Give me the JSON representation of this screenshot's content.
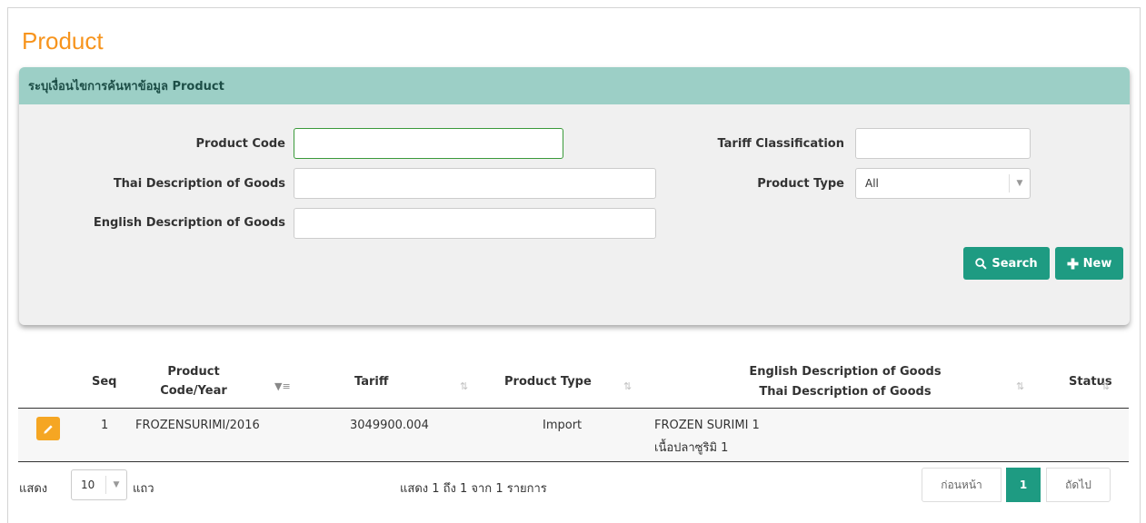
{
  "page": {
    "title": "Product"
  },
  "search_panel": {
    "header": "ระบุเงื่อนไขการค้นหาข้อมูล Product",
    "product_code_label": "Product Code",
    "product_code_value": "",
    "thai_desc_label": "Thai Description of Goods",
    "thai_desc_value": "",
    "english_desc_label": "English Description of Goods",
    "english_desc_value": "",
    "tariff_label": "Tariff Classification",
    "tariff_value": "",
    "product_type_label": "Product Type",
    "product_type_value": "All",
    "search_button": "Search",
    "new_button": "New"
  },
  "table": {
    "columns": {
      "seq": "Seq",
      "product_code": "Product Code/Year",
      "tariff": "Tariff",
      "product_type": "Product Type",
      "english_desc": "English Description of Goods",
      "thai_desc": "Thai Description of Goods",
      "status": "Status"
    },
    "rows": [
      {
        "seq": "1",
        "product_code": "FROZENSURIMI/2016",
        "tariff": "3049900.004",
        "product_type": "Import",
        "english_desc": "FROZEN SURIMI 1",
        "thai_desc": "เนื้อปลาซูริมิ 1",
        "status": ""
      }
    ]
  },
  "footer": {
    "show_label": "แสดง",
    "page_size": "10",
    "rows_label": "แถว",
    "info": "แสดง 1 ถึง 1 จาก 1 รายการ",
    "prev": "ก่อนหน้า",
    "current_page": "1",
    "next": "ถัดไป"
  },
  "colors": {
    "accent": "#1e9b82",
    "title": "#f7941d",
    "header_bg": "#9ccfc6",
    "edit": "#f5a623"
  }
}
